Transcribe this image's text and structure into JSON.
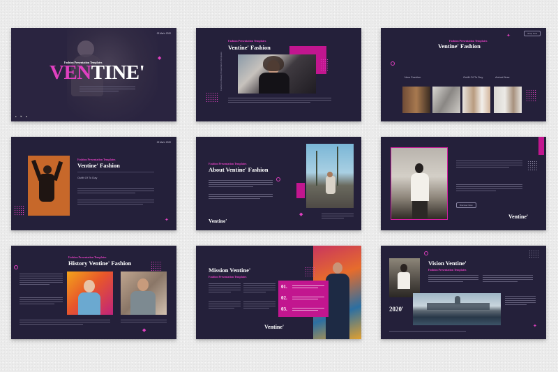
{
  "slides": {
    "s1": {
      "year": "02 Mar'n 2020",
      "kicker": "Fashion Presentation Templates",
      "title_a": "VEN",
      "title_b": "TINE'"
    },
    "s2": {
      "kicker": "Fashion Presentation Templates",
      "title": "Ventine' Fashion",
      "vertical": "Fashion & Beauty Presentation Templates"
    },
    "s3": {
      "title": "Ventine' Fashion",
      "kicker": "Fashion Presentation Templates",
      "button": "Shop Now",
      "labels": [
        "New Fashion",
        "Outfit Of To Day",
        "Arrival Now"
      ]
    },
    "s4": {
      "year": "02 Mar'n 2020",
      "kicker": "Fashion Presentation Templates",
      "title": "Ventine' Fashion",
      "sub": "Outfit Of To Day"
    },
    "s5": {
      "kicker": "Fashion Presentation Templates",
      "title": "About Ventine' Fashion",
      "brand": "Ventine'"
    },
    "s6": {
      "button": "Discover Now",
      "brand": "Ventine'"
    },
    "s7": {
      "kicker": "Fashion Presentation Templates",
      "title": "History Ventine' Fashion"
    },
    "s8": {
      "title": "Mission Ventine'",
      "kicker": "Fashion Presentation Templates",
      "nums": [
        "01.",
        "02.",
        "03."
      ],
      "brand": "Ventine'"
    },
    "s9": {
      "title": "Vision Ventine'",
      "kicker": "Fashion Presentation Templates",
      "year": "2020'"
    }
  },
  "colors": {
    "slide_bg": "#24203a",
    "accent": "#e040c0",
    "accent_dark": "#c2168f"
  }
}
